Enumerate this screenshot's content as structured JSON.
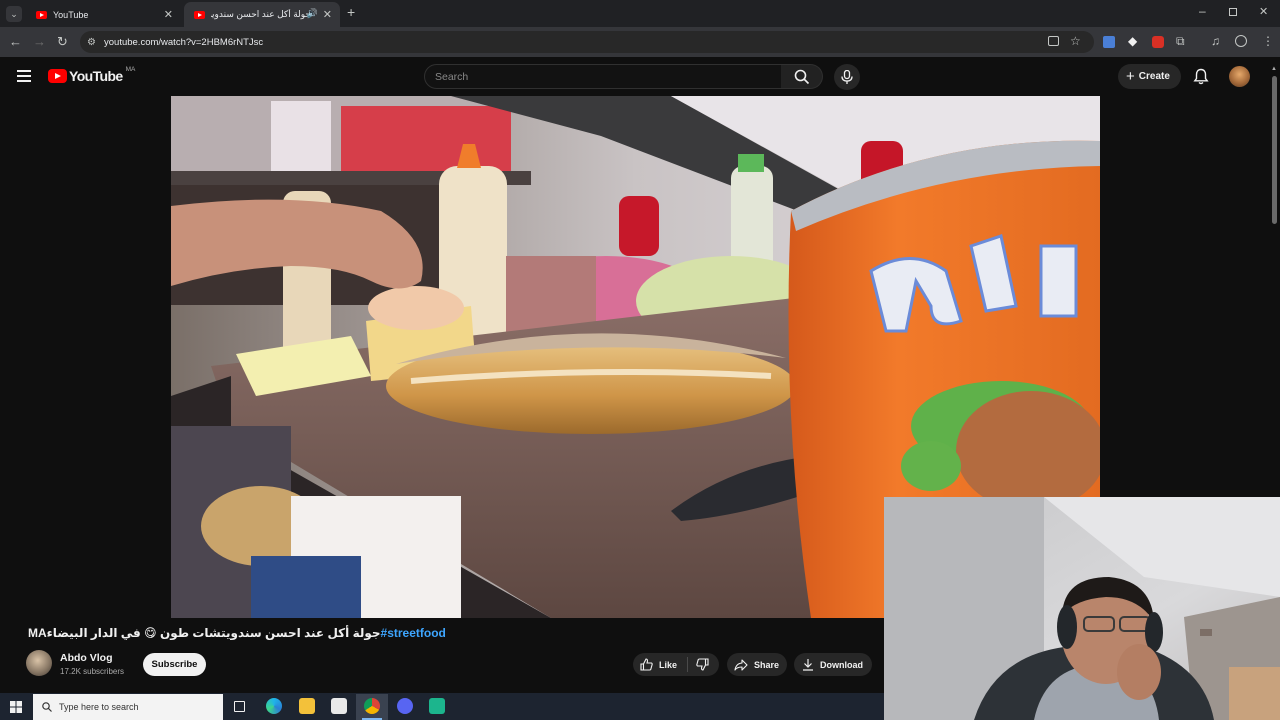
{
  "browser": {
    "tabs": [
      {
        "title": "YouTube",
        "active": false
      },
      {
        "title": "جولة أكل عند احسن سندويت...",
        "active": true
      }
    ],
    "url": "youtube.com/watch?v=2HBM6rNTJsc"
  },
  "youtube": {
    "logo_text": "YouTube",
    "region": "MA",
    "search_placeholder": "Search",
    "create_label": "Create"
  },
  "video": {
    "title_prefix": "MAجولة أكل عند احسن سندويتشات طون 😋 في الدار البيضاء",
    "title_hashtag": "#streetfood",
    "channel": "Abdo Vlog",
    "subscribers": "17.2K subscribers",
    "subscribe_label": "Subscribe",
    "actions": {
      "like": "Like",
      "share": "Share",
      "download": "Download"
    }
  },
  "taskbar": {
    "search_placeholder": "Type here to search"
  },
  "colors": {
    "brand_red": "#ff0000",
    "link_blue": "#3ea6ff",
    "page_bg": "#0f0f0f"
  }
}
